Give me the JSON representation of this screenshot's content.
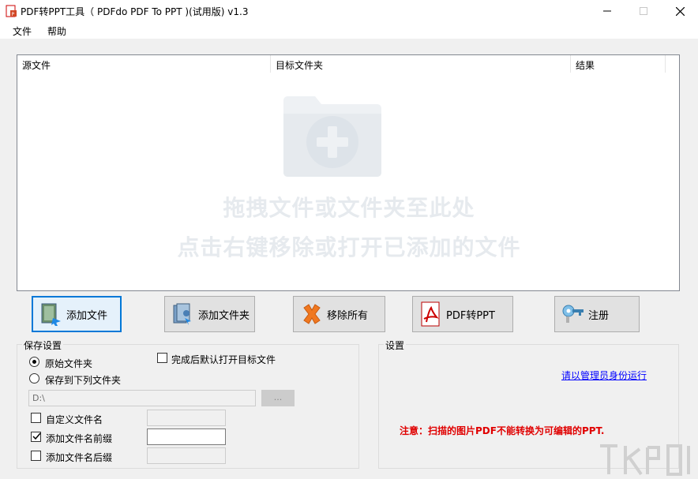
{
  "window": {
    "title": "PDF转PPT工具（ PDFdo PDF To PPT )(试用版) v1.3"
  },
  "menu": {
    "file": "文件",
    "help": "帮助"
  },
  "filelist": {
    "columns": [
      "源文件",
      "目标文件夹",
      "结果"
    ],
    "hint_line1": "拖拽文件或文件夹至此处",
    "hint_line2": "点击右键移除或打开已添加的文件"
  },
  "toolbar": {
    "add_file": "添加文件",
    "add_folder": "添加文件夹",
    "remove_all": "移除所有",
    "convert": "PDF转PPT",
    "register": "注册"
  },
  "save_settings": {
    "title": "保存设置",
    "original_folder": "原始文件夹",
    "save_to_folder": "保存到下列文件夹",
    "open_after": "完成后默认打开目标文件",
    "folder_path": "D:\\",
    "browse": "...",
    "custom_name": "自定义文件名",
    "add_prefix": "添加文件名前缀",
    "add_suffix": "添加文件名后缀"
  },
  "settings": {
    "title": "设置",
    "admin_link": "请以管理员身份运行",
    "notice": "注意：扫描的图片PDF不能转换为可编辑的PPT."
  },
  "colors": {
    "accent": "#0078d7",
    "warning": "#e00000",
    "link": "#0000ff"
  }
}
